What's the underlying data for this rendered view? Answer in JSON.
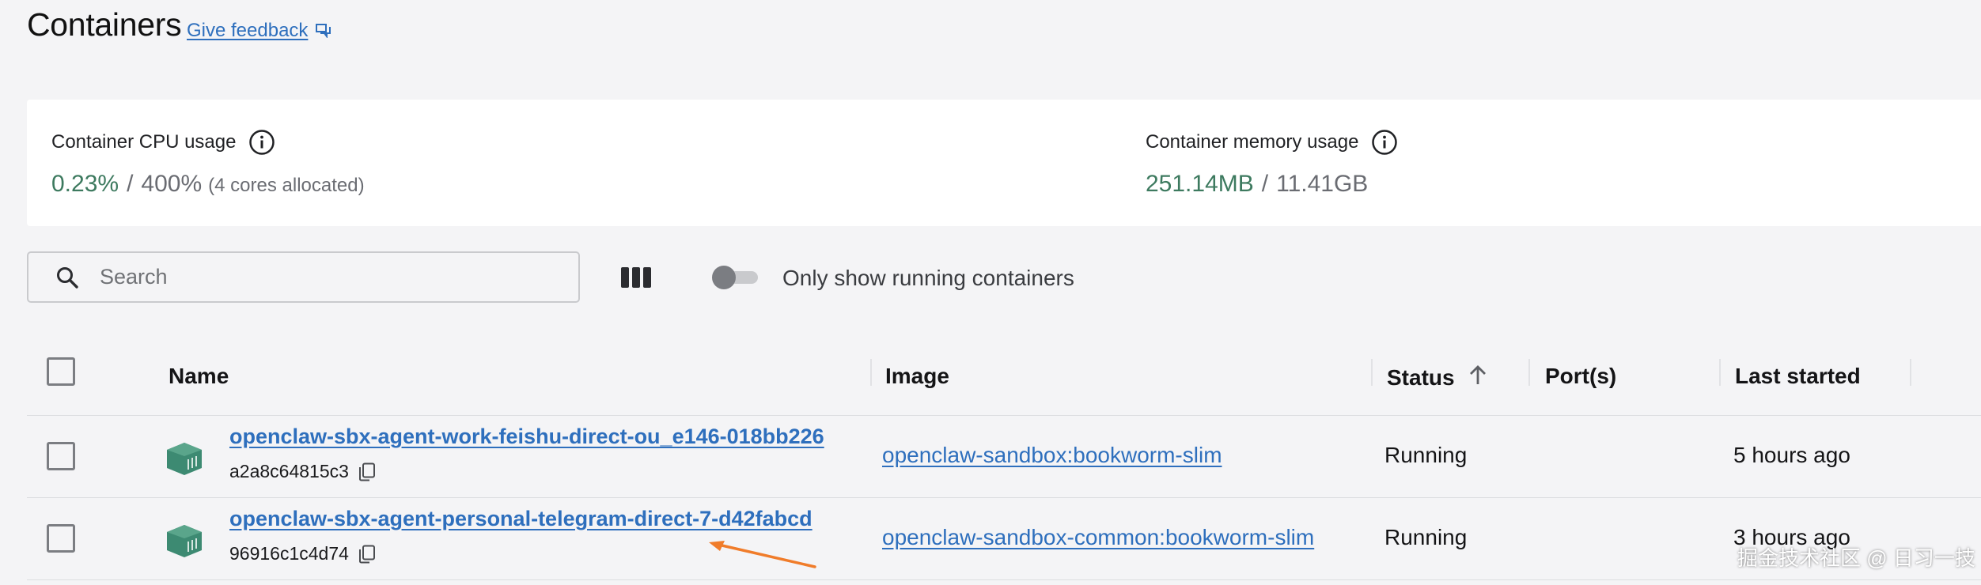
{
  "header": {
    "title": "Containers",
    "feedback_label": "Give feedback"
  },
  "stats": {
    "cpu": {
      "label": "Container CPU usage",
      "used": "0.23%",
      "separator": "/",
      "total": "400%",
      "note": "(4 cores allocated)"
    },
    "memory": {
      "label": "Container memory usage",
      "used": "251.14MB",
      "separator": "/",
      "total": "11.41GB"
    }
  },
  "toolbar": {
    "search_placeholder": "Search",
    "running_toggle_label": "Only show running containers",
    "running_toggle_on": false
  },
  "table": {
    "columns": {
      "name": "Name",
      "image": "Image",
      "status": "Status",
      "ports": "Port(s)",
      "last_started": "Last started"
    },
    "rows": [
      {
        "name": "openclaw-sbx-agent-work-feishu-direct-ou_e146-018bb226",
        "id": "a2a8c64815c3",
        "image": "openclaw-sandbox:bookworm-slim",
        "status": "Running",
        "ports": "",
        "last_started": "5 hours ago"
      },
      {
        "name": "openclaw-sbx-agent-personal-telegram-direct-7-d42fabcd",
        "id": "96916c1c4d74",
        "image": "openclaw-sandbox-common:bookworm-slim",
        "status": "Running",
        "ports": "",
        "last_started": "3 hours ago"
      }
    ]
  },
  "watermark": "掘金技术社区 @ 日习一技",
  "colors": {
    "accent_link": "#2e6fbd",
    "stat_green": "#3d7a5f",
    "container_icon": "#3d8a72",
    "annotation_arrow": "#f07c2a"
  }
}
